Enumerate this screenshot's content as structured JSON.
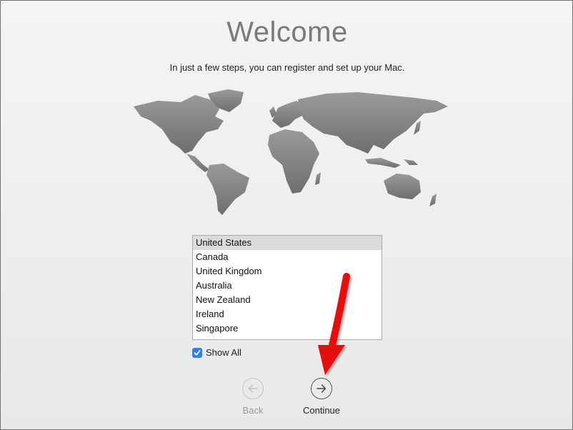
{
  "welcome": {
    "title": "Welcome",
    "subtitle": "In just a few steps, you can register and set up your Mac."
  },
  "country_list": {
    "items": [
      "United States",
      "Canada",
      "United Kingdom",
      "Australia",
      "New Zealand",
      "Ireland",
      "Singapore"
    ],
    "selected": "United States"
  },
  "show_all": {
    "label": "Show All",
    "checked": true
  },
  "navigation": {
    "back_label": "Back",
    "continue_label": "Continue",
    "back_icon": "left-arrow-circle-icon",
    "continue_icon": "right-arrow-circle-icon"
  },
  "colors": {
    "accent": "#2f7dfb",
    "annotation_arrow": "#e8100d",
    "map": "#8c8c8c"
  }
}
